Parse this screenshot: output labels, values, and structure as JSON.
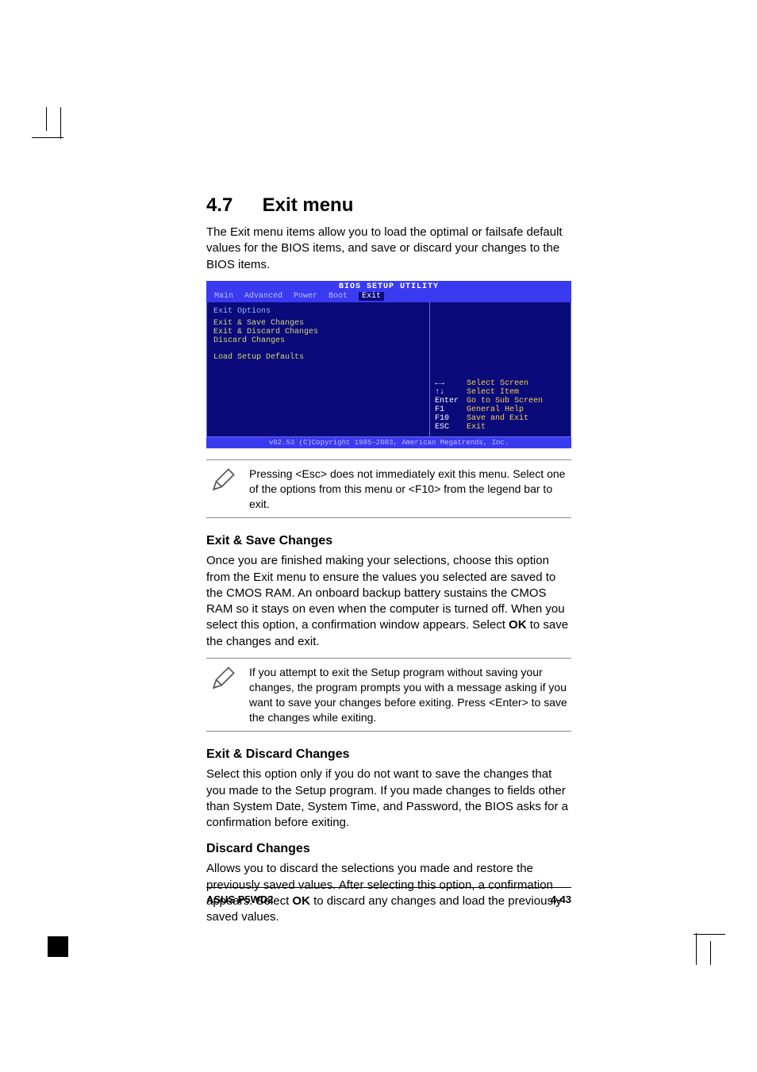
{
  "section": {
    "number": "4.7",
    "title": "Exit menu"
  },
  "intro": "The Exit menu items allow you to load the optimal or failsafe default values for the BIOS items, and save or discard your changes to the BIOS items.",
  "bios": {
    "header": "BIOS SETUP UTILITY",
    "tabs": [
      "Main",
      "Advanced",
      "Power",
      "Boot",
      "Exit"
    ],
    "active_tab": "Exit",
    "group_label": "Exit Options",
    "items": [
      "Exit & Save Changes",
      "Exit & Discard Changes",
      "Discard Changes"
    ],
    "extra_item": "Load Setup Defaults",
    "legend": [
      {
        "k": "←→",
        "v": "Select Screen"
      },
      {
        "k": "↑↓",
        "v": "Select Item"
      },
      {
        "k": "Enter",
        "v": "Go to Sub Screen"
      },
      {
        "k": "F1",
        "v": "General Help"
      },
      {
        "k": "F10",
        "v": "Save and Exit"
      },
      {
        "k": "ESC",
        "v": "Exit"
      }
    ],
    "footer": "v02.53 (C)Copyright 1985-2003, American Megatrends, Inc."
  },
  "note1": "Pressing <Esc> does not immediately exit this menu. Select one of the options from this menu or <F10> from the legend bar to exit.",
  "sec1": {
    "title": "Exit & Save Changes",
    "body_a": "Once you are finished making your selections, choose this option from the Exit menu to ensure the values you selected are saved to the CMOS RAM. An onboard backup battery sustains the CMOS RAM so it stays on even when the computer is turned off. When you select this option, a confirmation window appears. Select ",
    "ok": "OK",
    "body_b": " to save the changes and exit."
  },
  "note2": " If you attempt to exit the Setup program without saving your changes, the program prompts you with a message asking if you want to save your changes before exiting. Press <Enter>  to save the  changes while exiting.",
  "sec2": {
    "title": "Exit & Discard Changes",
    "body": "Select this option only if you do not want to save the changes that you made to the Setup program. If you made changes to fields other than System Date, System Time, and Password, the BIOS asks for a confirmation before exiting."
  },
  "sec3": {
    "title": "Discard Changes",
    "body_a": "Allows you to discard the selections you made and restore the previously saved values. After selecting this option, a confirmation appears. Select ",
    "ok": "OK",
    "body_b": " to discard any changes and load the previously saved values."
  },
  "footer": {
    "left": "ASUS P5WD2",
    "right": "4-43"
  }
}
